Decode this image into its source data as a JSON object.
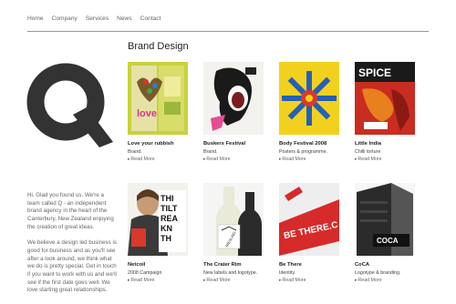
{
  "nav": [
    "Home",
    "Company",
    "Services",
    "News",
    "Contact"
  ],
  "page_title": "Brand Design",
  "intro": [
    "Hi. Glad you found us. We're a team called Q - an independent brand agency in the heart of the Canterbury, New Zealand enjoying the creation of great ideas.",
    "We believe a design led business is good for business and as you'll see after a look around, we think what we do is pretty special. Get in touch if you want to work with us and we'll see if the first date goes well. We love starting great relationships."
  ],
  "more_label": "Read More",
  "projects": [
    {
      "title": "Love your rubbish",
      "subtitle": "Brand.",
      "thumb_text": "love"
    },
    {
      "title": "Buskers Festival",
      "subtitle": "Brand.",
      "thumb_text": ""
    },
    {
      "title": "Body Festival 2008",
      "subtitle": "Posters & programme.",
      "thumb_text": ""
    },
    {
      "title": "Little India",
      "subtitle": "Chilli torture",
      "thumb_text": "SPICE"
    },
    {
      "title": "Netcoil",
      "subtitle": "2008 Campaign",
      "thumb_text": "THIS TILT REALLY KNTH"
    },
    {
      "title": "The Crater Rim",
      "subtitle": "New labels and logotype.",
      "thumb_text": "RIESLING"
    },
    {
      "title": "Be There",
      "subtitle": "Identity.",
      "thumb_text": "BE THERE.C"
    },
    {
      "title": "CoCA",
      "subtitle": "Logotype & branding.",
      "thumb_text": "COCA"
    }
  ]
}
